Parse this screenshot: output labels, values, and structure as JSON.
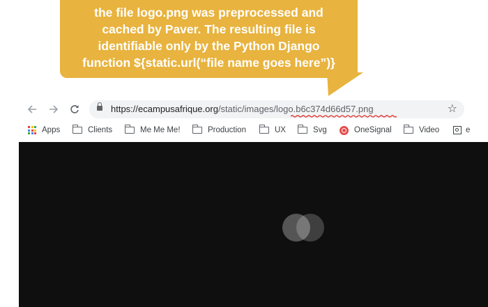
{
  "annotation": {
    "lines": [
      "the file logo.png was preprocessed and",
      "cached by Paver. The resulting file is",
      "identifiable only by the Python Django",
      "function ${static.url(“file name goes here”)}"
    ],
    "color": "#e8b33e"
  },
  "browser": {
    "nav": {
      "back_icon": "arrow-left-icon",
      "forward_icon": "arrow-right-icon",
      "reload_icon": "reload-icon"
    },
    "address": {
      "scheme": "https://",
      "host": "ecampusafrique.org",
      "path": "/static/images/",
      "file": "logo.b6c374d66d57.png"
    },
    "bookmarks": [
      {
        "label": "Apps",
        "icon": "apps-grid-icon"
      },
      {
        "label": "Clients",
        "icon": "folder-icon"
      },
      {
        "label": "Me Me Me!",
        "icon": "folder-icon"
      },
      {
        "label": "Production",
        "icon": "folder-icon"
      },
      {
        "label": "UX",
        "icon": "folder-icon"
      },
      {
        "label": "Svg",
        "icon": "folder-icon"
      },
      {
        "label": "OneSignal",
        "icon": "onesignal-icon"
      },
      {
        "label": "Video",
        "icon": "folder-icon"
      },
      {
        "label": "e",
        "icon": "extension-icon"
      }
    ]
  },
  "page": {
    "background": "#0f0f0f"
  }
}
